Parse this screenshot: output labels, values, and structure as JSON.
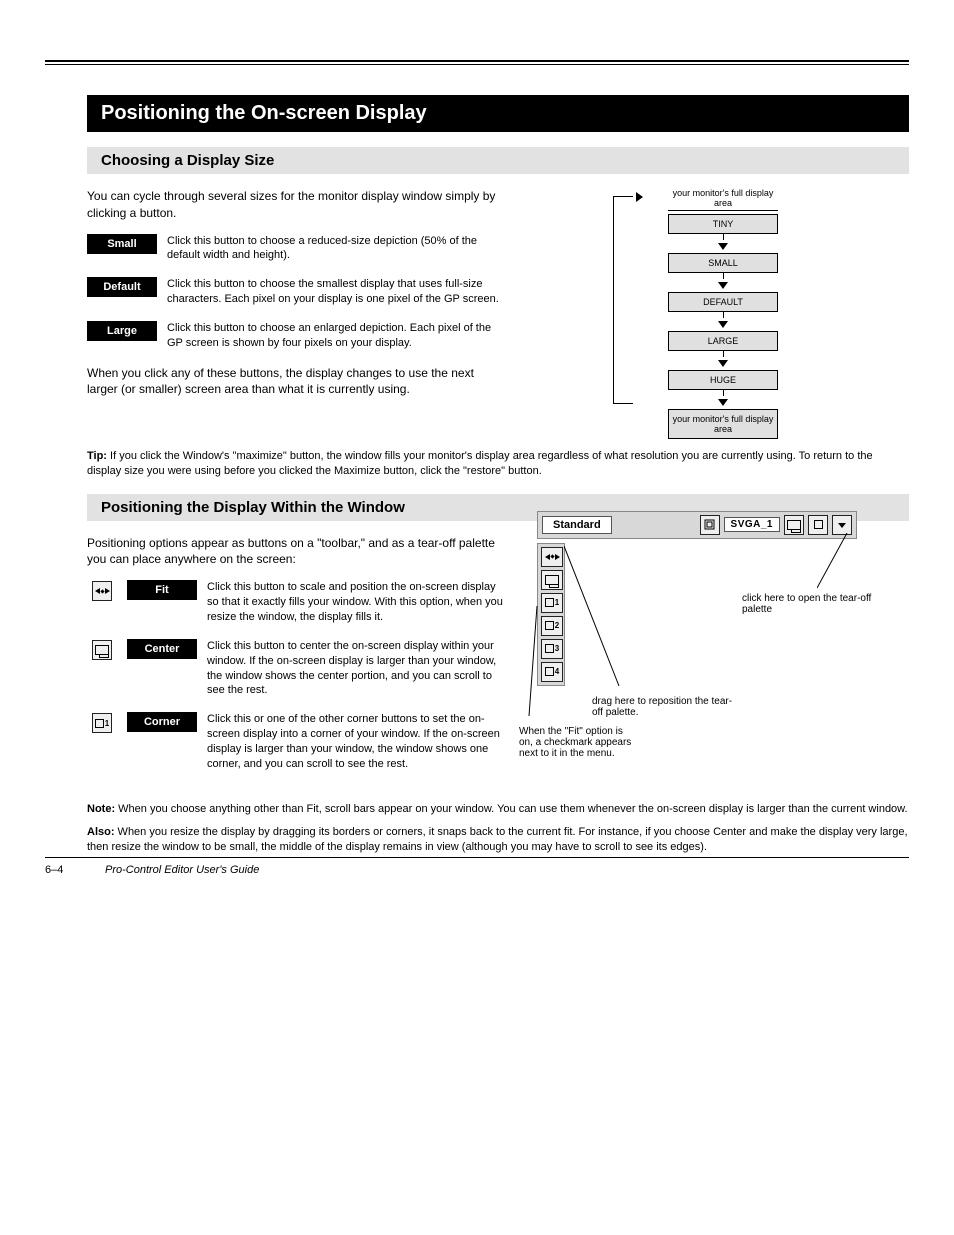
{
  "banner": "Positioning the On-screen Display",
  "section1": {
    "title": "Choosing a Display Size",
    "intro": "You can cycle through several sizes for the monitor display window simply by clicking a button.",
    "buttons": [
      {
        "label": "Small",
        "desc": "Click this button to choose a reduced-size depiction (50% of the default width and height)."
      },
      {
        "label": "Default",
        "desc": "Click this button to choose the smallest display that uses full-size characters. Each pixel on your display is one pixel of the GP screen."
      },
      {
        "label": "Large",
        "desc": "Click this button to choose an enlarged depiction. Each pixel of the GP screen is shown by four pixels on your display."
      }
    ],
    "para_after": "When you click any of these buttons, the display changes to use the next larger (or smaller) screen area than what it is currently using.",
    "tip_label": "Tip:",
    "tip": "If you click the Window's \"maximize\" button, the window fills your monitor's display area regardless of what resolution you are currently using. To return to the display size you were using before you clicked the Maximize button, click the \"restore\" button.",
    "flow": {
      "top_label": "your monitor's full display area",
      "boxes": [
        "TINY",
        "SMALL",
        "DEFAULT",
        "LARGE",
        "HUGE",
        "your monitor's full display area"
      ]
    }
  },
  "section2": {
    "title": "Positioning the Display Within the Window",
    "intro": "Positioning options appear as buttons on a \"toolbar,\" and as a tear-off palette you can place anywhere on the screen:",
    "items": [
      {
        "label": "Fit",
        "desc": "Click this button to scale and position the on-screen display so that it exactly fills your window. With this option, when you resize the window, the display fills it."
      },
      {
        "label": "Center",
        "desc": "Click this button to center the on-screen display within your window. If the on-screen display is larger than your window, the window shows the center portion, and you can scroll to see the rest."
      },
      {
        "label": "Corner",
        "desc": "Click this or one of the other corner buttons to set the on-screen display into a corner of your window. If the on-screen display is larger than your window, the window shows one corner, and you can scroll to see the rest."
      }
    ],
    "callout_a": "click here to open the tear-off palette",
    "callout_b": "drag here to reposition the tear-off palette.",
    "callout_c": "When the \"Fit\" option is on, a checkmark appears next to it in the menu.",
    "notes": [
      {
        "bold": "Note:",
        "text": " When you choose anything other than Fit, scroll bars appear on your window. You can use them whenever the on-screen display is larger than the current window."
      },
      {
        "bold": "Also:",
        "text": " When you resize the display by dragging its borders or corners, it snaps back to the current fit. For instance, if you choose Center and make the display very large, then resize the window to be small, the middle of the display remains in view (although you may have to scroll to see its edges)."
      }
    ],
    "toolbar": {
      "standard": "Standard",
      "svga": "SVGA_1"
    }
  },
  "footer": {
    "page": "6–4",
    "title": "Pro-Control Editor User's Guide"
  }
}
